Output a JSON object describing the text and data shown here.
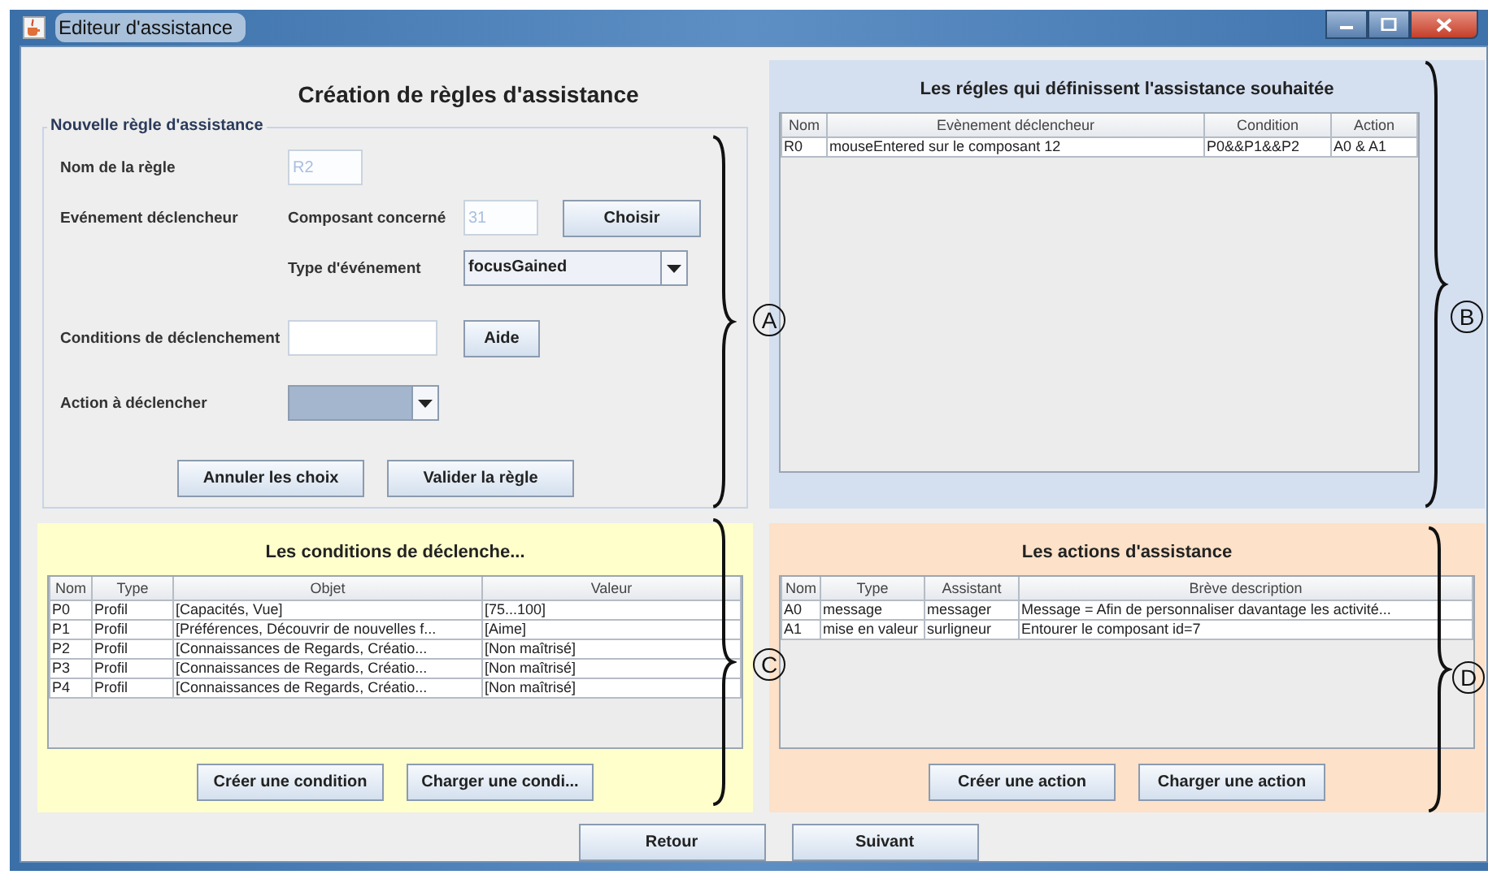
{
  "window": {
    "title": "Editeur d'assistance"
  },
  "rule_form": {
    "title": "Création de règles d'assistance",
    "group_label": "Nouvelle règle d'assistance",
    "name_label": "Nom de la règle",
    "name_field": {
      "value": "R2",
      "disabled": true
    },
    "event_label": "Evénement déclencheur",
    "component_label": "Composant concerné",
    "component_field": {
      "value": "31",
      "disabled": true
    },
    "choose_button": "Choisir",
    "event_type_label": "Type d'événement",
    "event_type_value": "focusGained",
    "conditions_label": "Conditions de déclenchement",
    "help_button": "Aide",
    "action_label": "Action à déclencher",
    "buttons": [
      "Annuler les choix",
      "Valider la règle"
    ]
  },
  "rules_panel": {
    "title": "Les régles qui définissent l'assistance souhaitée",
    "table": {
      "columns": [
        "Nom",
        "Evènement déclencheur",
        "Condition",
        "Action"
      ],
      "rows": [
        [
          "R0",
          "mouseEntered sur le composant 12",
          "P0&&P1&&P2",
          "A0 & A1"
        ]
      ]
    }
  },
  "conditions_panel": {
    "title": "Les conditions de déclenche...",
    "table": {
      "columns": [
        "Nom",
        "Type",
        "Objet",
        "Valeur"
      ],
      "rows": [
        [
          "P0",
          "Profil",
          "[Capacités, Vue]",
          "[75...100]"
        ],
        [
          "P1",
          "Profil",
          "[Préférences, Découvrir de nouvelles f...",
          "[Aime]"
        ],
        [
          "P2",
          "Profil",
          "[Connaissances de Regards, Créatio...",
          "[Non maîtrisé]"
        ],
        [
          "P3",
          "Profil",
          "[Connaissances de Regards, Créatio...",
          "[Non maîtrisé]"
        ],
        [
          "P4",
          "Profil",
          "[Connaissances de Regards, Créatio...",
          "[Non maîtrisé]"
        ]
      ]
    },
    "buttons": [
      "Créer une condition",
      "Charger une condi..."
    ]
  },
  "actions_panel": {
    "title": "Les actions d'assistance",
    "table": {
      "columns": [
        "Nom",
        "Type",
        "Assistant",
        "Brève description"
      ],
      "rows": [
        [
          "A0",
          "message",
          "messager",
          "Message = Afin de personnaliser davantage les activité..."
        ],
        [
          "A1",
          "mise en valeur",
          "surligneur",
          "Entourer le composant id=7"
        ]
      ]
    },
    "buttons": [
      "Créer une action",
      "Charger une action"
    ]
  },
  "nav_buttons": [
    "Retour",
    "Suivant"
  ],
  "annotations": [
    "A",
    "B",
    "C",
    "D"
  ]
}
